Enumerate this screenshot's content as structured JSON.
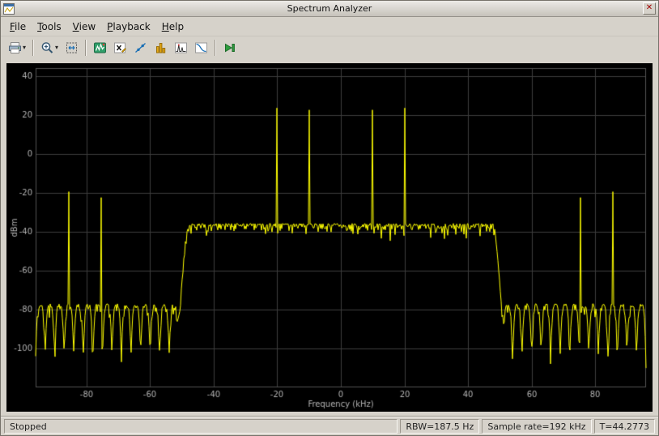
{
  "window": {
    "title": "Spectrum Analyzer",
    "close_glyph": "✕"
  },
  "menu": {
    "items": [
      "File",
      "Tools",
      "View",
      "Playback",
      "Help"
    ]
  },
  "toolbar": {
    "dropdown_glyph": "▾",
    "icons": [
      {
        "name": "print-icon",
        "dropdown": true
      },
      {
        "name": "zoom-in-icon",
        "dropdown": true
      },
      {
        "name": "fit-to-view-icon",
        "dropdown": false
      },
      {
        "name": "spectrum-settings-icon",
        "dropdown": false
      },
      {
        "name": "cursor-measurements-icon",
        "dropdown": false
      },
      {
        "name": "signal-statistics-icon",
        "dropdown": false
      },
      {
        "name": "peak-finder-icon",
        "dropdown": false
      },
      {
        "name": "distortion-measurements-icon",
        "dropdown": false
      },
      {
        "name": "ccdf-measurements-icon",
        "dropdown": false
      },
      {
        "name": "step-forward-icon",
        "dropdown": false
      }
    ]
  },
  "status": {
    "state": "Stopped",
    "rbw": "RBW=187.5 Hz",
    "sample_rate": "Sample rate=192 kHz",
    "time": "T=44.2773"
  },
  "chart_data": {
    "type": "line",
    "title": "",
    "xlabel": "Frequency (kHz)",
    "ylabel": "dBm",
    "xlim": [
      -96,
      96
    ],
    "ylim": [
      -120,
      44
    ],
    "xticks": [
      -80,
      -60,
      -40,
      -20,
      0,
      20,
      40,
      60,
      80
    ],
    "yticks": [
      40,
      20,
      0,
      -20,
      -40,
      -60,
      -80,
      -100
    ],
    "grid": true,
    "legend": "none",
    "background_color": "#000000",
    "grid_color": "#3d3d3d",
    "axis_text_color": "#b0b0b0",
    "line_color": "#ffff00",
    "passband": {
      "freq_start": -48,
      "freq_end": 48,
      "mean_level_dbm": -38
    },
    "transition_width_khz": 3.5,
    "stopband": {
      "peak_level_dbm": -79,
      "null_level_dbm": -105,
      "ripple_period_khz": 3
    },
    "spikes": [
      {
        "freq_khz": -85.5,
        "level_dbm": -19.5
      },
      {
        "freq_khz": -75.5,
        "level_dbm": -22.5
      },
      {
        "freq_khz": -20,
        "level_dbm": 23.5
      },
      {
        "freq_khz": -10,
        "level_dbm": 22.5
      },
      {
        "freq_khz": 10,
        "level_dbm": 22.5
      },
      {
        "freq_khz": 20,
        "level_dbm": 23.5
      },
      {
        "freq_khz": 75.5,
        "level_dbm": -22.5
      },
      {
        "freq_khz": 85.5,
        "level_dbm": -19.5
      }
    ]
  }
}
